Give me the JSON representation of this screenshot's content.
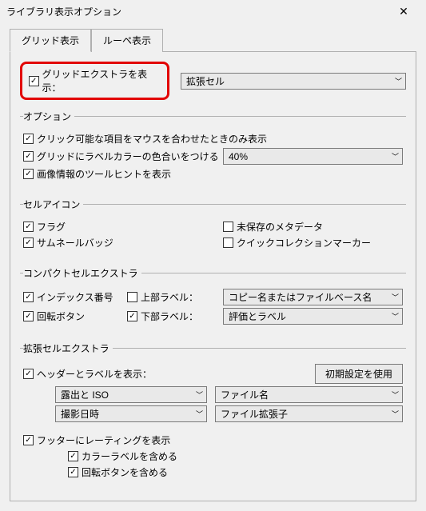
{
  "window": {
    "title": "ライブラリ表示オプション"
  },
  "tabs": {
    "grid": "グリッド表示",
    "loupe": "ルーペ表示"
  },
  "showGridExtras": "グリッドエクストラを表示：",
  "expandedCells": "拡張セル",
  "groups": {
    "options": {
      "title": "オプション",
      "clickable": "クリック可能な項目をマウスを合わせたときのみ表示",
      "tintLabel": "グリッドにラベルカラーの色合いをつける",
      "tintValue": "40%",
      "tooltip": "画像情報のツールヒントを表示"
    },
    "cellIcons": {
      "title": "セルアイコン",
      "flag": "フラグ",
      "unsaved": "未保存のメタデータ",
      "thumbBadge": "サムネールバッジ",
      "quickMarker": "クイックコレクションマーカー"
    },
    "compact": {
      "title": "コンパクトセルエクストラ",
      "indexNo": "インデックス番号",
      "topLabel": "上部ラベル：",
      "topValue": "コピー名またはファイルベース名",
      "rotation": "回転ボタン",
      "bottomLabel": "下部ラベル：",
      "bottomValue": "評価とラベル"
    },
    "expanded": {
      "title": "拡張セルエクストラ",
      "showHeader": "ヘッダーとラベルを表示：",
      "useDefaults": "初期設定を使用",
      "sel1": "露出と ISO",
      "sel2": "ファイル名",
      "sel3": "撮影日時",
      "sel4": "ファイル拡張子",
      "showFooterRating": "フッターにレーティングを表示",
      "includeColor": "カラーラベルを含める",
      "includeRotation": "回転ボタンを含める"
    }
  }
}
